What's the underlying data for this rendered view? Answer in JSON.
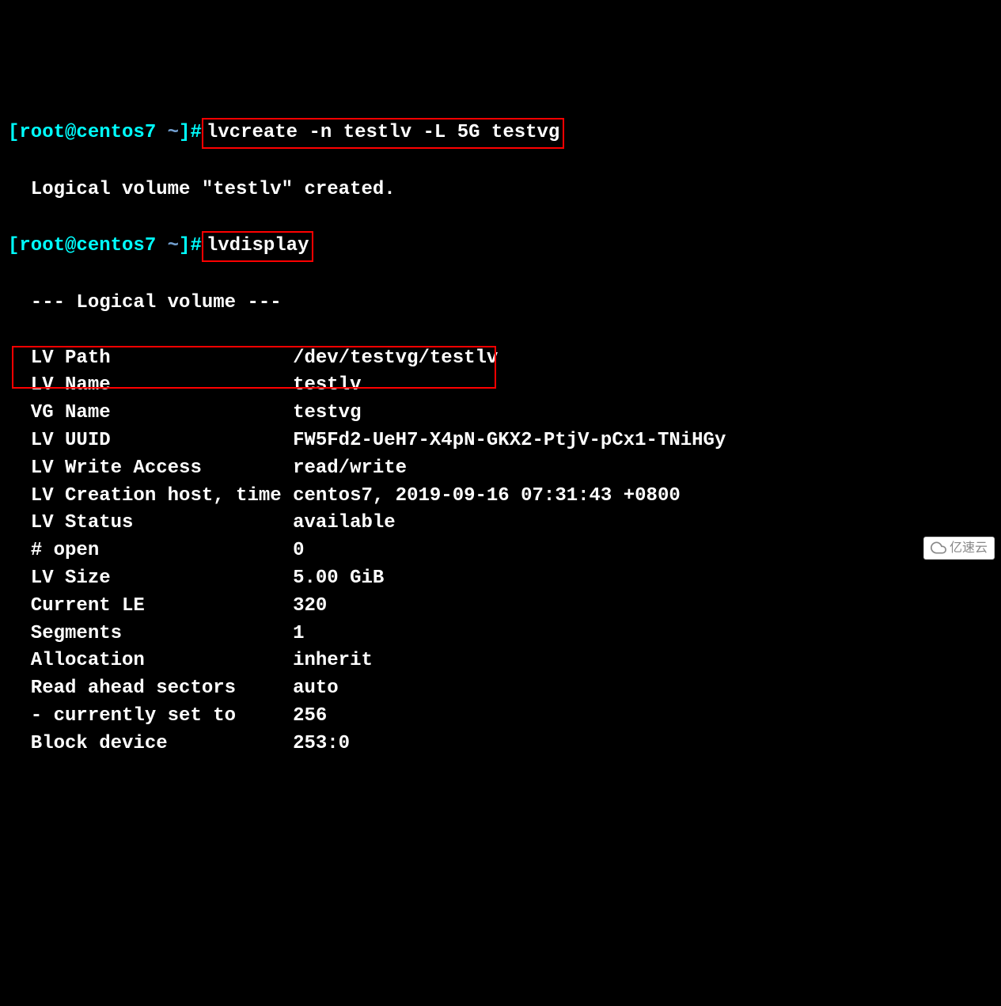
{
  "prompt1": {
    "user_host": "[root@centos7 ",
    "tilde": "~",
    "suffix": "]#",
    "command": "lvcreate -n testlv -L 5G testvg"
  },
  "created_line": "  Logical volume \"testlv\" created.",
  "prompt2": {
    "user_host": "[root@centos7 ",
    "tilde": "~",
    "suffix": "]#",
    "command": "lvdisplay"
  },
  "header_line": "  --- Logical volume ---",
  "fields": [
    {
      "label": "  LV Path                ",
      "value": "/dev/testvg/testlv"
    },
    {
      "label": "  LV Name                ",
      "value": "testlv"
    },
    {
      "label": "  VG Name                ",
      "value": "testvg"
    },
    {
      "label": "  LV UUID                ",
      "value": "FW5Fd2-UeH7-X4pN-GKX2-PtjV-pCx1-TNiHGy"
    },
    {
      "label": "  LV Write Access        ",
      "value": "read/write"
    },
    {
      "label": "  LV Creation host, time ",
      "value": "centos7, 2019-09-16 07:31:43 +0800"
    },
    {
      "label": "  LV Status              ",
      "value": "available"
    },
    {
      "label": "  # open                 ",
      "value": "0"
    },
    {
      "label": "  LV Size                ",
      "value": "5.00 GiB"
    },
    {
      "label": "  Current LE             ",
      "value": "320"
    },
    {
      "label": "  Segments               ",
      "value": "1"
    },
    {
      "label": "  Allocation             ",
      "value": "inherit"
    },
    {
      "label": "  Read ahead sectors     ",
      "value": "auto"
    },
    {
      "label": "  - currently set to     ",
      "value": "256"
    },
    {
      "label": "  Block device           ",
      "value": "253:0"
    }
  ],
  "watermark": {
    "text": "亿速云"
  }
}
